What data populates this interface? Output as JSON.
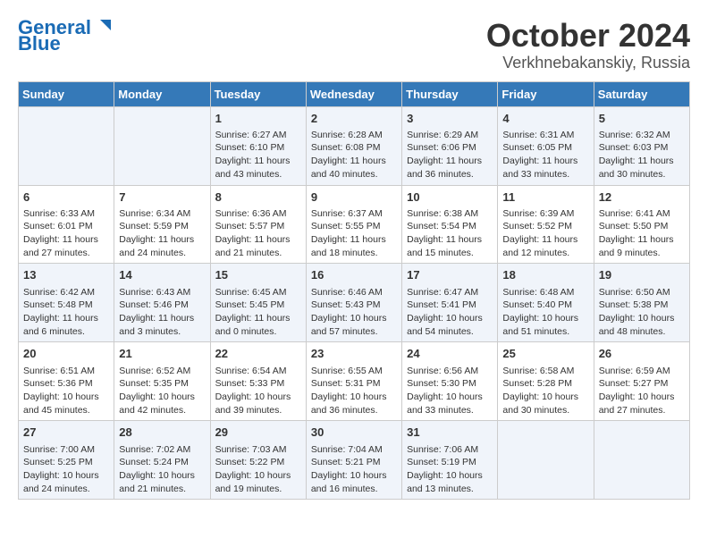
{
  "logo": {
    "line1": "General",
    "line2": "Blue"
  },
  "title": "October 2024",
  "subtitle": "Verkhnebakanskiy, Russia",
  "days_header": [
    "Sunday",
    "Monday",
    "Tuesday",
    "Wednesday",
    "Thursday",
    "Friday",
    "Saturday"
  ],
  "weeks": [
    [
      {
        "day": "",
        "info": ""
      },
      {
        "day": "",
        "info": ""
      },
      {
        "day": "1",
        "info": "Sunrise: 6:27 AM\nSunset: 6:10 PM\nDaylight: 11 hours and 43 minutes."
      },
      {
        "day": "2",
        "info": "Sunrise: 6:28 AM\nSunset: 6:08 PM\nDaylight: 11 hours and 40 minutes."
      },
      {
        "day": "3",
        "info": "Sunrise: 6:29 AM\nSunset: 6:06 PM\nDaylight: 11 hours and 36 minutes."
      },
      {
        "day": "4",
        "info": "Sunrise: 6:31 AM\nSunset: 6:05 PM\nDaylight: 11 hours and 33 minutes."
      },
      {
        "day": "5",
        "info": "Sunrise: 6:32 AM\nSunset: 6:03 PM\nDaylight: 11 hours and 30 minutes."
      }
    ],
    [
      {
        "day": "6",
        "info": "Sunrise: 6:33 AM\nSunset: 6:01 PM\nDaylight: 11 hours and 27 minutes."
      },
      {
        "day": "7",
        "info": "Sunrise: 6:34 AM\nSunset: 5:59 PM\nDaylight: 11 hours and 24 minutes."
      },
      {
        "day": "8",
        "info": "Sunrise: 6:36 AM\nSunset: 5:57 PM\nDaylight: 11 hours and 21 minutes."
      },
      {
        "day": "9",
        "info": "Sunrise: 6:37 AM\nSunset: 5:55 PM\nDaylight: 11 hours and 18 minutes."
      },
      {
        "day": "10",
        "info": "Sunrise: 6:38 AM\nSunset: 5:54 PM\nDaylight: 11 hours and 15 minutes."
      },
      {
        "day": "11",
        "info": "Sunrise: 6:39 AM\nSunset: 5:52 PM\nDaylight: 11 hours and 12 minutes."
      },
      {
        "day": "12",
        "info": "Sunrise: 6:41 AM\nSunset: 5:50 PM\nDaylight: 11 hours and 9 minutes."
      }
    ],
    [
      {
        "day": "13",
        "info": "Sunrise: 6:42 AM\nSunset: 5:48 PM\nDaylight: 11 hours and 6 minutes."
      },
      {
        "day": "14",
        "info": "Sunrise: 6:43 AM\nSunset: 5:46 PM\nDaylight: 11 hours and 3 minutes."
      },
      {
        "day": "15",
        "info": "Sunrise: 6:45 AM\nSunset: 5:45 PM\nDaylight: 11 hours and 0 minutes."
      },
      {
        "day": "16",
        "info": "Sunrise: 6:46 AM\nSunset: 5:43 PM\nDaylight: 10 hours and 57 minutes."
      },
      {
        "day": "17",
        "info": "Sunrise: 6:47 AM\nSunset: 5:41 PM\nDaylight: 10 hours and 54 minutes."
      },
      {
        "day": "18",
        "info": "Sunrise: 6:48 AM\nSunset: 5:40 PM\nDaylight: 10 hours and 51 minutes."
      },
      {
        "day": "19",
        "info": "Sunrise: 6:50 AM\nSunset: 5:38 PM\nDaylight: 10 hours and 48 minutes."
      }
    ],
    [
      {
        "day": "20",
        "info": "Sunrise: 6:51 AM\nSunset: 5:36 PM\nDaylight: 10 hours and 45 minutes."
      },
      {
        "day": "21",
        "info": "Sunrise: 6:52 AM\nSunset: 5:35 PM\nDaylight: 10 hours and 42 minutes."
      },
      {
        "day": "22",
        "info": "Sunrise: 6:54 AM\nSunset: 5:33 PM\nDaylight: 10 hours and 39 minutes."
      },
      {
        "day": "23",
        "info": "Sunrise: 6:55 AM\nSunset: 5:31 PM\nDaylight: 10 hours and 36 minutes."
      },
      {
        "day": "24",
        "info": "Sunrise: 6:56 AM\nSunset: 5:30 PM\nDaylight: 10 hours and 33 minutes."
      },
      {
        "day": "25",
        "info": "Sunrise: 6:58 AM\nSunset: 5:28 PM\nDaylight: 10 hours and 30 minutes."
      },
      {
        "day": "26",
        "info": "Sunrise: 6:59 AM\nSunset: 5:27 PM\nDaylight: 10 hours and 27 minutes."
      }
    ],
    [
      {
        "day": "27",
        "info": "Sunrise: 7:00 AM\nSunset: 5:25 PM\nDaylight: 10 hours and 24 minutes."
      },
      {
        "day": "28",
        "info": "Sunrise: 7:02 AM\nSunset: 5:24 PM\nDaylight: 10 hours and 21 minutes."
      },
      {
        "day": "29",
        "info": "Sunrise: 7:03 AM\nSunset: 5:22 PM\nDaylight: 10 hours and 19 minutes."
      },
      {
        "day": "30",
        "info": "Sunrise: 7:04 AM\nSunset: 5:21 PM\nDaylight: 10 hours and 16 minutes."
      },
      {
        "day": "31",
        "info": "Sunrise: 7:06 AM\nSunset: 5:19 PM\nDaylight: 10 hours and 13 minutes."
      },
      {
        "day": "",
        "info": ""
      },
      {
        "day": "",
        "info": ""
      }
    ]
  ]
}
